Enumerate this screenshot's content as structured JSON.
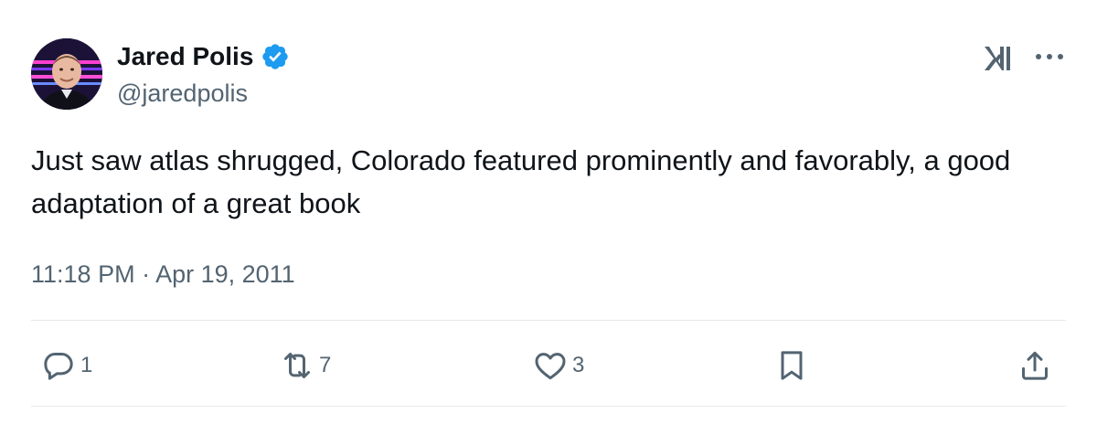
{
  "author": {
    "name": "Jared Polis",
    "handle": "@jaredpolis",
    "verified_color": "#1d9bf0"
  },
  "tweet": {
    "text": "Just saw atlas shrugged, Colorado featured prominently and favorably, a good adaptation of a great book",
    "timestamp": "11:18 PM · Apr 19, 2011"
  },
  "actions": {
    "reply_count": "1",
    "retweet_count": "7",
    "like_count": "3"
  },
  "icons": {
    "reply": "reply-icon",
    "retweet": "retweet-icon",
    "like": "heart-icon",
    "bookmark": "bookmark-icon",
    "share": "share-icon",
    "logo": "x-logo-icon",
    "more": "more-icon"
  },
  "colors": {
    "text": "#0f1419",
    "secondary": "#536471",
    "divider": "#e6e9eb"
  }
}
